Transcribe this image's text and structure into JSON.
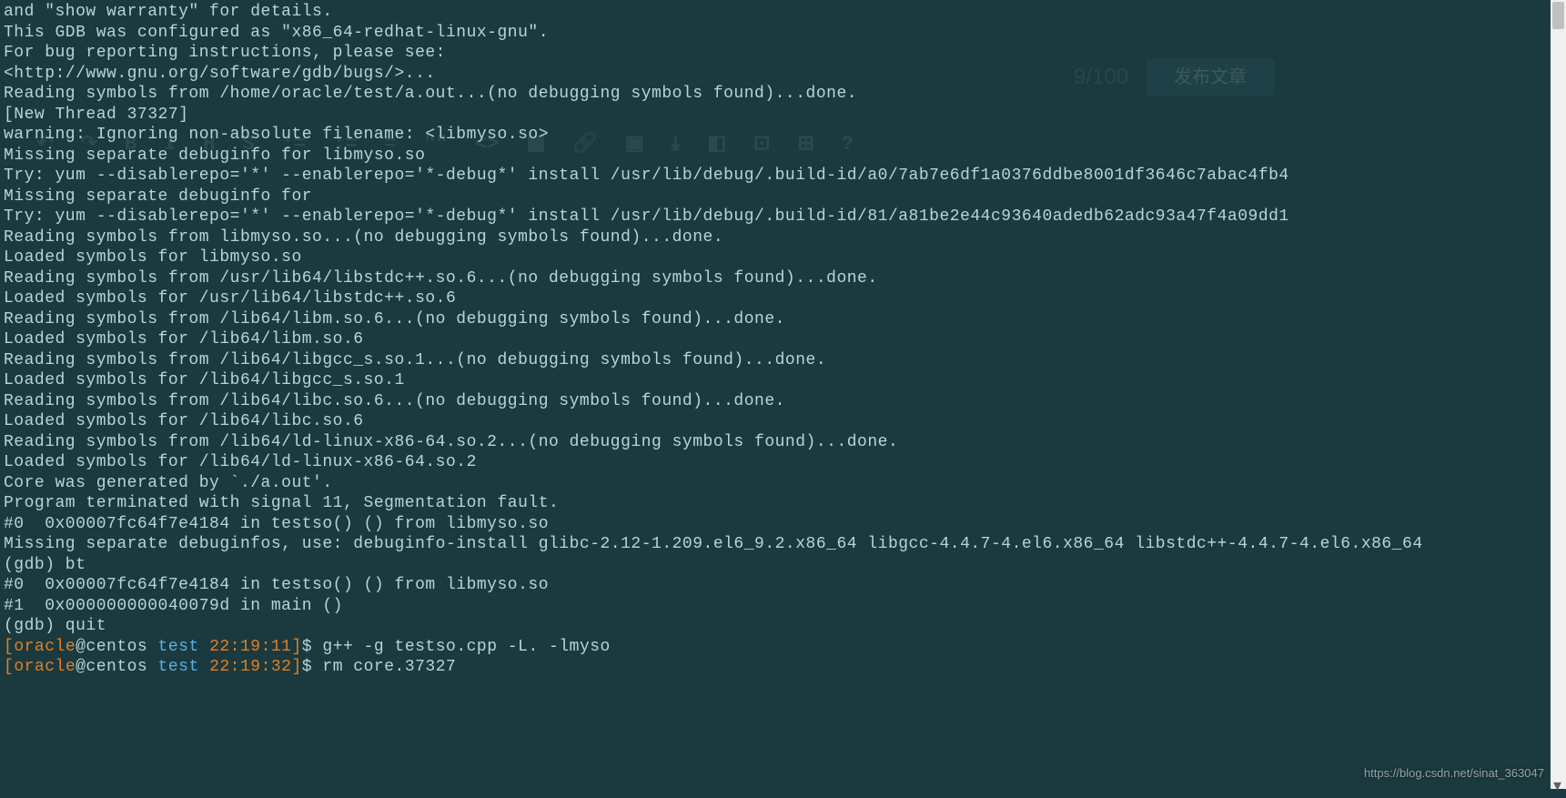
{
  "terminal": {
    "lines": [
      "and \"show warranty\" for details.",
      "This GDB was configured as \"x86_64-redhat-linux-gnu\".",
      "For bug reporting instructions, please see:",
      "<http://www.gnu.org/software/gdb/bugs/>...",
      "Reading symbols from /home/oracle/test/a.out...(no debugging symbols found)...done.",
      "[New Thread 37327]",
      "",
      "warning: Ignoring non-absolute filename: <libmyso.so>",
      "Missing separate debuginfo for libmyso.so",
      "Try: yum --disablerepo='*' --enablerepo='*-debug*' install /usr/lib/debug/.build-id/a0/7ab7e6df1a0376ddbe8001df3646c7abac4fb4",
      "Missing separate debuginfo for ",
      "Try: yum --disablerepo='*' --enablerepo='*-debug*' install /usr/lib/debug/.build-id/81/a81be2e44c93640adedb62adc93a47f4a09dd1",
      "Reading symbols from libmyso.so...(no debugging symbols found)...done.",
      "Loaded symbols for libmyso.so",
      "Reading symbols from /usr/lib64/libstdc++.so.6...(no debugging symbols found)...done.",
      "Loaded symbols for /usr/lib64/libstdc++.so.6",
      "Reading symbols from /lib64/libm.so.6...(no debugging symbols found)...done.",
      "Loaded symbols for /lib64/libm.so.6",
      "Reading symbols from /lib64/libgcc_s.so.1...(no debugging symbols found)...done.",
      "Loaded symbols for /lib64/libgcc_s.so.1",
      "Reading symbols from /lib64/libc.so.6...(no debugging symbols found)...done.",
      "Loaded symbols for /lib64/libc.so.6",
      "Reading symbols from /lib64/ld-linux-x86-64.so.2...(no debugging symbols found)...done.",
      "Loaded symbols for /lib64/ld-linux-x86-64.so.2",
      "Core was generated by `./a.out'.",
      "Program terminated with signal 11, Segmentation fault.",
      "#0  0x00007fc64f7e4184 in testso() () from libmyso.so",
      "Missing separate debuginfos, use: debuginfo-install glibc-2.12-1.209.el6_9.2.x86_64 libgcc-4.4.7-4.el6.x86_64 libstdc++-4.4.7-4.el6.x86_64",
      "(gdb) bt",
      "#0  0x00007fc64f7e4184 in testso() () from libmyso.so",
      "#1  0x000000000040079d in main ()",
      "(gdb) quit"
    ]
  },
  "prompts": [
    {
      "user": "oracle",
      "at": "@",
      "host": "centos ",
      "path": "test ",
      "time": "22:19:11",
      "cmd": "g++ -g testso.cpp -L. -lmyso"
    },
    {
      "user": "oracle",
      "at": "@",
      "host": "centos ",
      "path": "test ",
      "time": "22:19:32",
      "cmd": "rm core.37327"
    }
  ],
  "bg": {
    "counter": "9/100",
    "publish": "发布文章",
    "toolbar": [
      "↶",
      "↷",
      "B",
      "I",
      "H",
      "S",
      ":=",
      ":=",
      "=",
      "\"\"",
      "<>",
      "▦",
      "🔗",
      "▣",
      "⤓",
      "◧",
      "⊡",
      "⊞",
      "?"
    ]
  },
  "watermark": "https://blog.csdn.net/sinat_363047"
}
